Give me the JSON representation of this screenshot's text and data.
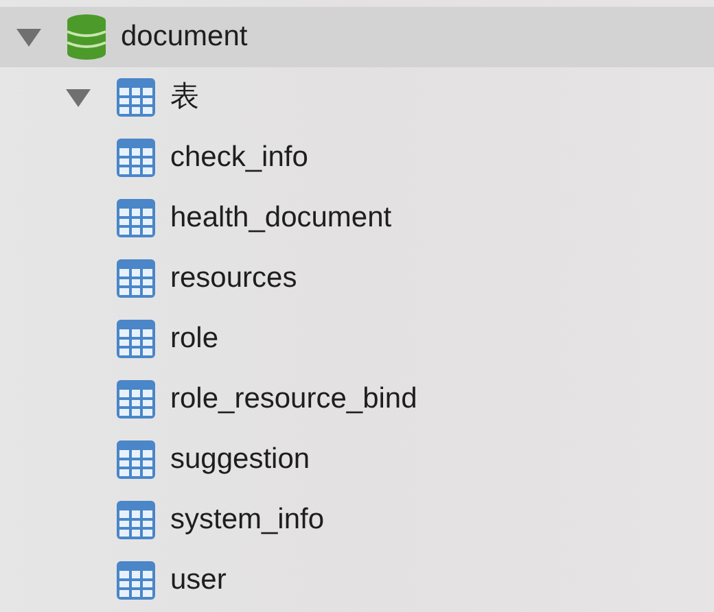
{
  "tree": [
    {
      "kind": "database",
      "label": "document",
      "expanded": true,
      "selected": true,
      "children": [
        {
          "kind": "group",
          "label": "表",
          "expanded": true,
          "selected": false,
          "children": [
            {
              "kind": "table",
              "label": "check_info",
              "selected": false
            },
            {
              "kind": "table",
              "label": "health_document",
              "selected": false
            },
            {
              "kind": "table",
              "label": "resources",
              "selected": false
            },
            {
              "kind": "table",
              "label": "role",
              "selected": false
            },
            {
              "kind": "table",
              "label": "role_resource_bind",
              "selected": false
            },
            {
              "kind": "table",
              "label": "suggestion",
              "selected": false
            },
            {
              "kind": "table",
              "label": "system_info",
              "selected": false
            },
            {
              "kind": "table",
              "label": "user",
              "selected": false
            }
          ]
        }
      ]
    }
  ]
}
